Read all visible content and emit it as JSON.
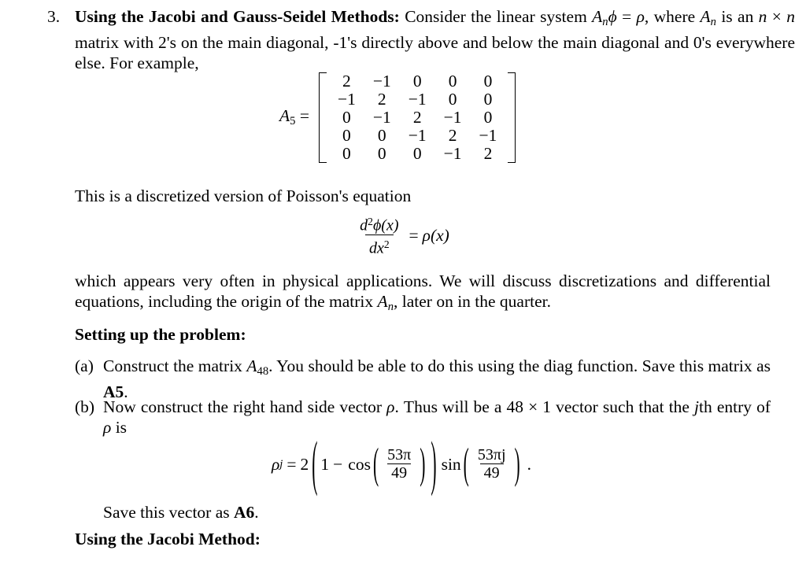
{
  "document": {
    "problem_number": "3.",
    "title": "Using the Jacobi and Gauss-Seidel Methods:",
    "intro_part1": "Consider the linear system ",
    "intro_A": "A",
    "intro_A_sub": "n",
    "intro_phi": "ϕ",
    "intro_equals": " =",
    "intro_line2_start": "ρ",
    "intro_line2": ", where ",
    "intro_An_2": "A",
    "intro_An_2_sub": "n",
    "intro_line2b": " is an ",
    "intro_n1": "n",
    "intro_cross": " × ",
    "intro_n2": "n",
    "intro_line2c": " matrix with 2's on the main diagonal, -1's directly above and below the main diagonal and 0's everywhere else.  For example,"
  },
  "matrix": {
    "label_A": "A",
    "label_sub": "5",
    "label_equals": "=",
    "rows": [
      [
        "2",
        "−1",
        "0",
        "0",
        "0"
      ],
      [
        "−1",
        "2",
        "−1",
        "0",
        "0"
      ],
      [
        "0",
        "−1",
        "2",
        "−1",
        "0"
      ],
      [
        "0",
        "0",
        "−1",
        "2",
        "−1"
      ],
      [
        "0",
        "0",
        "0",
        "−1",
        "2"
      ]
    ]
  },
  "poisson": {
    "caption": "This is a discretized version of Poisson's equation",
    "equation": {
      "numerator_d": "d",
      "numerator_sup": "2",
      "numerator_phi": "ϕ(x)",
      "denominator": "dx",
      "denominator_sup": "2",
      "equals": "=",
      "rhs": "ρ(x)"
    }
  },
  "discussion": {
    "line1": "which appears very often in physical applications.  We will discuss discretizations and differential equations, including the origin of the matrix ",
    "matrix_A": "A",
    "matrix_A_sub": "n",
    "line2": ", later on in the quarter."
  },
  "setup": {
    "heading": "Setting up the problem:",
    "items": [
      {
        "marker": "(a)",
        "text_before": "Construct the matrix ",
        "matrix_name": "A",
        "matrix_sub": "48",
        "text_after": ".  You should be able to do this using the diag function. Save this matrix as ",
        "save_as": "A5",
        "period": "."
      },
      {
        "marker": "(b)",
        "text_before": "Now construct the right hand side vector ",
        "rho": "ρ",
        "text_mid": ".  Thus will be a 48 × 1 vector such that the ",
        "j_var": "j",
        "text_after": "th entry of ",
        "rho2": "ρ",
        "text_end": " is"
      }
    ]
  },
  "rho_equation": {
    "rho": "ρ",
    "rho_sub": "j",
    "equals": "=",
    "coefficient": "2",
    "one": "1",
    "minus": "−",
    "cos": "cos",
    "cos_num": "53π",
    "cos_den": "49",
    "sin": "sin",
    "sin_num": "53πj",
    "sin_den": "49",
    "period": "."
  },
  "closing": {
    "save_vector_before": "Save this vector as ",
    "save_vector_name": "A6",
    "save_vector_period": ".",
    "jacobi_heading": "Using the Jacobi Method:"
  }
}
